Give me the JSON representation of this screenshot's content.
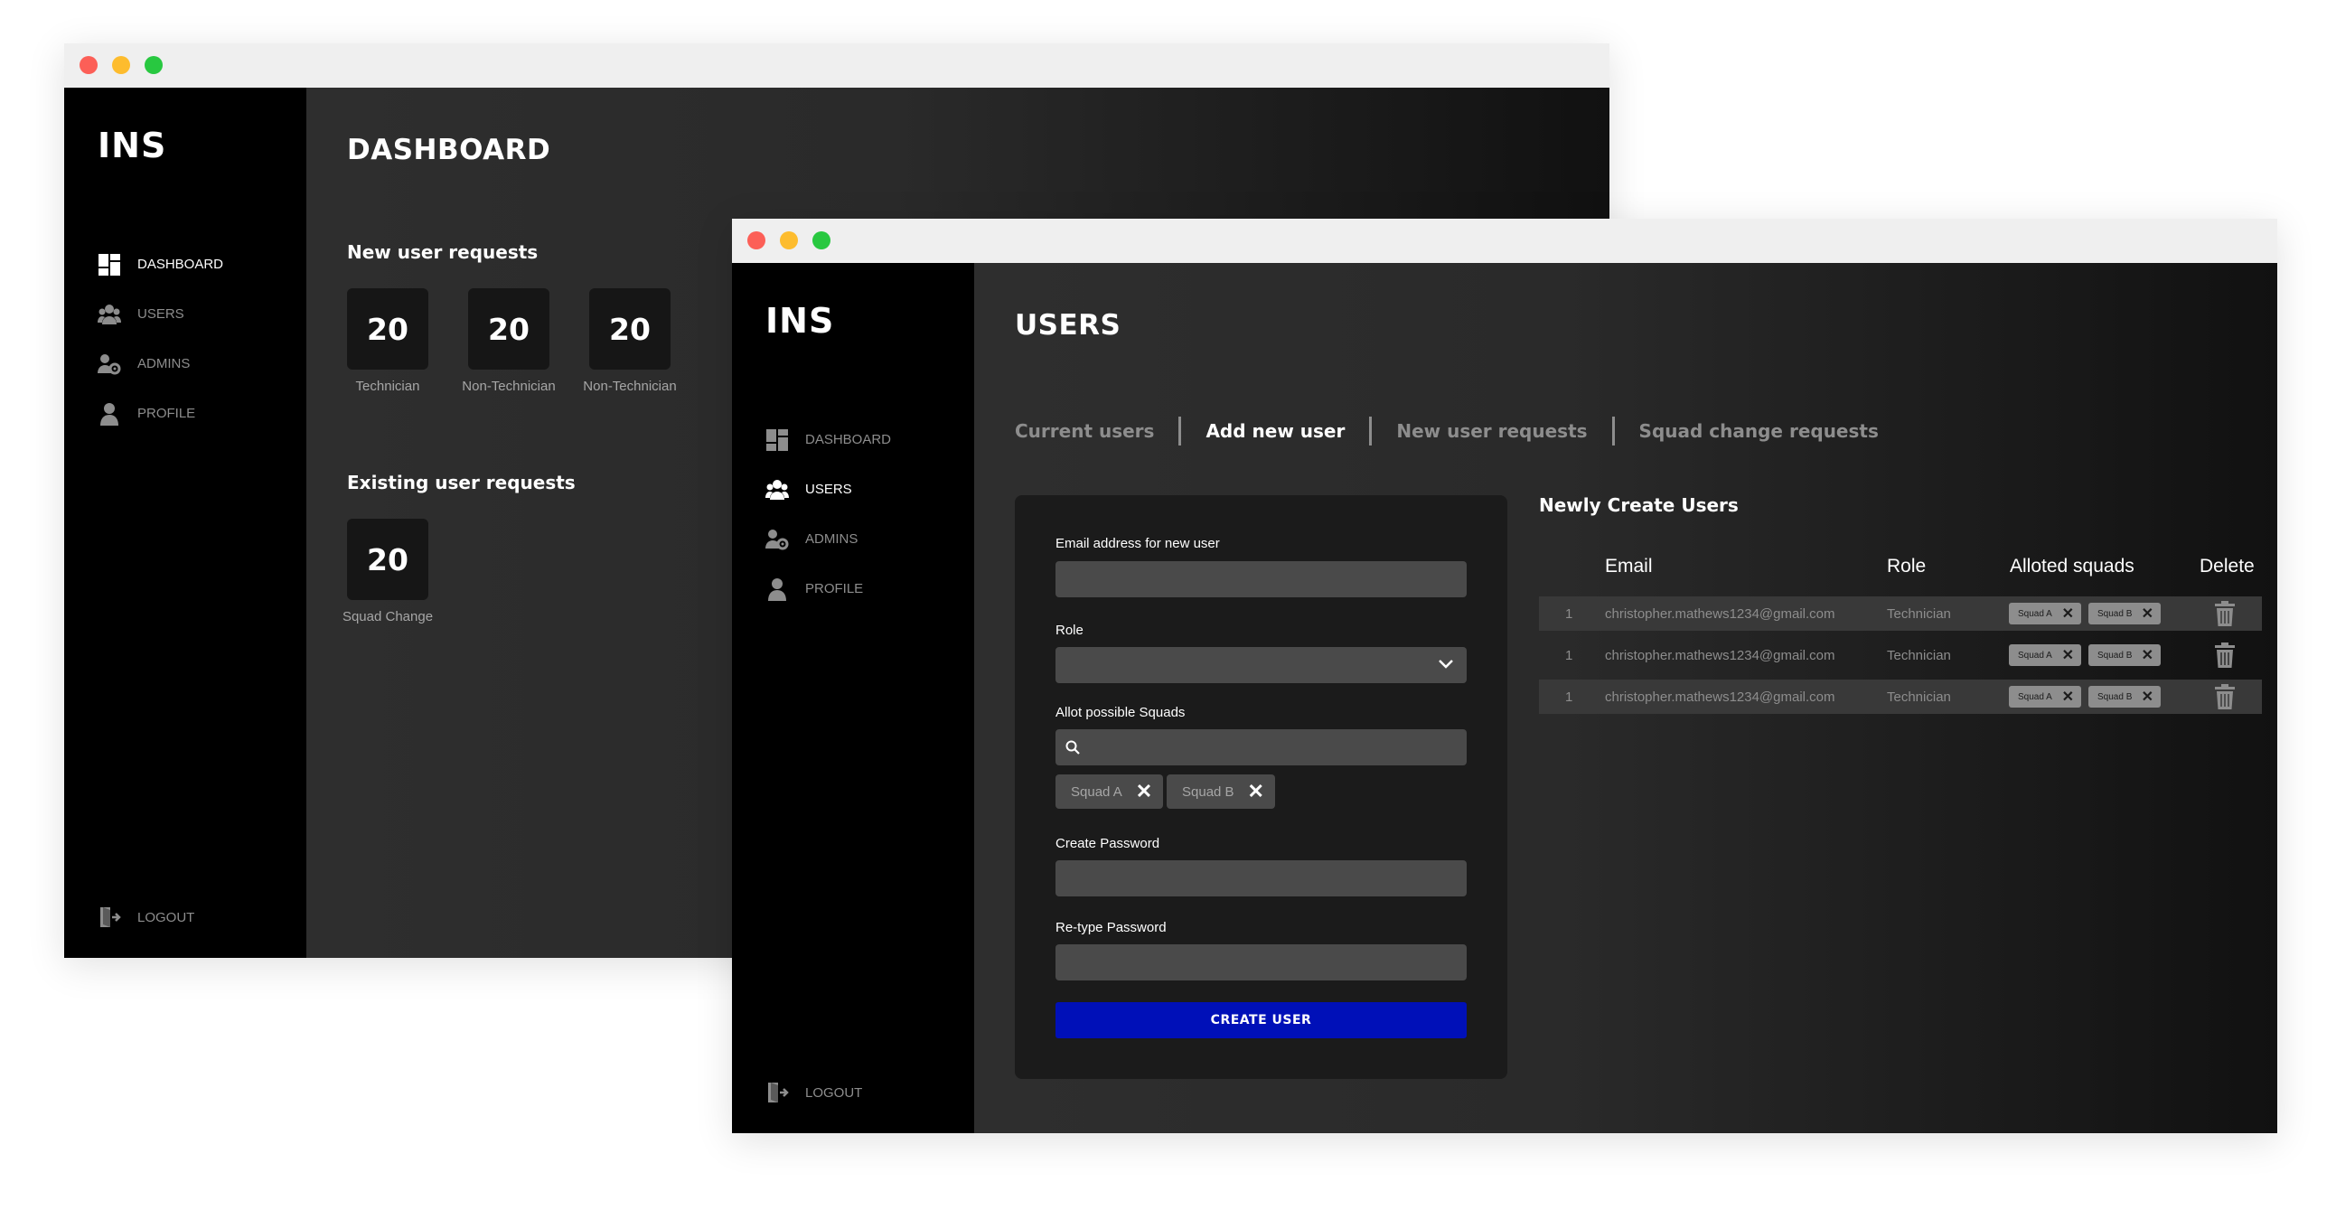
{
  "colors": {
    "accent": "#0010b8",
    "sidebar": "#000000",
    "content": "#2b2b2b",
    "muted": "#8d8d8d"
  },
  "window1": {
    "logo": "INS",
    "page_title": "DASHBOARD",
    "nav": [
      {
        "label": "DASHBOARD",
        "icon": "dashboard-icon",
        "active": true
      },
      {
        "label": "USERS",
        "icon": "users-icon",
        "active": false
      },
      {
        "label": "ADMINS",
        "icon": "admins-icon",
        "active": false
      },
      {
        "label": "PROFILE",
        "icon": "profile-icon",
        "active": false
      }
    ],
    "logout": "LOGOUT",
    "new_requests": {
      "heading": "New user requests",
      "stats": [
        {
          "value": "20",
          "label": "Technician"
        },
        {
          "value": "20",
          "label": "Non-Technician"
        },
        {
          "value": "20",
          "label": "Non-Technician"
        }
      ]
    },
    "existing_requests": {
      "heading": "Existing user requests",
      "stats": [
        {
          "value": "20",
          "label": "Squad Change"
        }
      ]
    }
  },
  "window2": {
    "logo": "INS",
    "page_title": "USERS",
    "nav": [
      {
        "label": "DASHBOARD",
        "icon": "dashboard-icon",
        "active": false
      },
      {
        "label": "USERS",
        "icon": "users-icon",
        "active": true
      },
      {
        "label": "ADMINS",
        "icon": "admins-icon",
        "active": false
      },
      {
        "label": "PROFILE",
        "icon": "profile-icon",
        "active": false
      }
    ],
    "logout": "LOGOUT",
    "tabs": [
      {
        "label": "Current users",
        "active": false
      },
      {
        "label": "Add new user",
        "active": true
      },
      {
        "label": "New user requests",
        "active": false
      },
      {
        "label": "Squad change requests",
        "active": false
      }
    ],
    "form": {
      "email_label": "Email address for new user",
      "email_value": "",
      "role_label": "Role",
      "role_value": "",
      "squads_label": "Allot possible Squads",
      "squads_search_value": "",
      "selected_squads": [
        "Squad A",
        "Squad B"
      ],
      "password_label": "Create Password",
      "retype_label": "Re-type Password",
      "submit_label": "CREATE USER"
    },
    "table": {
      "title": "Newly Create Users",
      "headers": {
        "email": "Email",
        "role": "Role",
        "squads": "Alloted squads",
        "delete": "Delete"
      },
      "rows": [
        {
          "num": "1",
          "email": "christopher.mathews1234@gmail.com",
          "role": "Technician",
          "squads": [
            "Squad A",
            "Squad B"
          ]
        },
        {
          "num": "1",
          "email": "christopher.mathews1234@gmail.com",
          "role": "Technician",
          "squads": [
            "Squad A",
            "Squad B"
          ]
        },
        {
          "num": "1",
          "email": "christopher.mathews1234@gmail.com",
          "role": "Technician",
          "squads": [
            "Squad A",
            "Squad B"
          ]
        }
      ]
    }
  }
}
